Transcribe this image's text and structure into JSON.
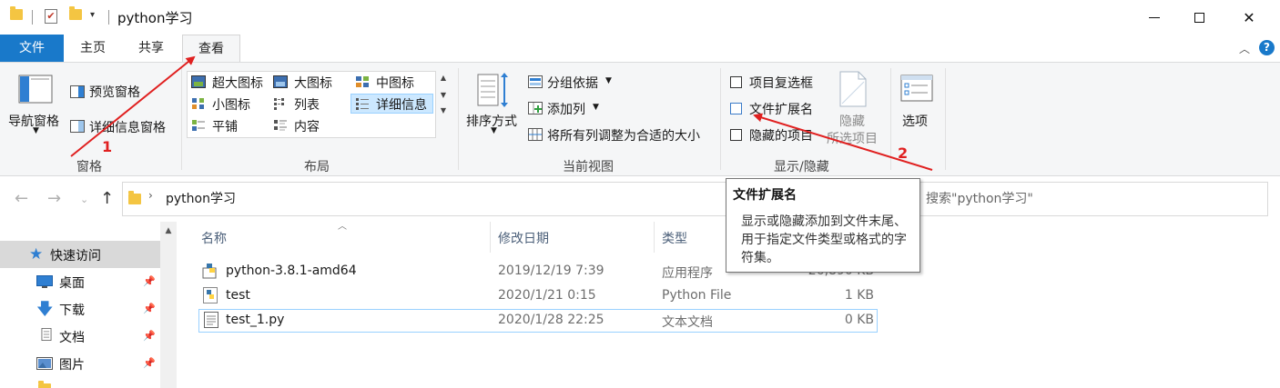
{
  "window": {
    "title": "python学习"
  },
  "ribbon_tabs": [
    "文件",
    "主页",
    "共享",
    "查看"
  ],
  "ribbon": {
    "panes": {
      "nav_pane": "导航窗格",
      "preview_pane": "预览窗格",
      "details_pane": "详细信息窗格",
      "label": "窗格"
    },
    "layout": {
      "items": [
        "超大图标",
        "大图标",
        "中图标",
        "小图标",
        "列表",
        "详细信息",
        "平铺",
        "内容"
      ],
      "selected": "详细信息",
      "label": "布局"
    },
    "current_view": {
      "sort_by": "排序方式",
      "group_by": "分组依据",
      "add_columns": "添加列",
      "size_all_columns": "将所有列调整为合适的大小",
      "label": "当前视图"
    },
    "show_hide": {
      "item_checkboxes": "项目复选框",
      "file_extensions": "文件扩展名",
      "hidden_items": "隐藏的项目",
      "hide_selected": "隐藏",
      "hide_selected_2": "所选项目",
      "label": "显示/隐藏"
    },
    "options": "选项"
  },
  "address": {
    "path": "python学习",
    "search_placeholder": "搜索\"python学习\""
  },
  "nav": {
    "items": [
      {
        "label": "快速访问",
        "icon": "star-icon"
      },
      {
        "label": "桌面",
        "icon": "desktop-icon"
      },
      {
        "label": "下载",
        "icon": "download-icon"
      },
      {
        "label": "文档",
        "icon": "document-icon"
      },
      {
        "label": "图片",
        "icon": "picture-icon"
      }
    ]
  },
  "columns": [
    "名称",
    "修改日期",
    "类型"
  ],
  "files": [
    {
      "name": "python-3.8.1-amd64",
      "date": "2019/12/19 7:39",
      "type": "应用程序",
      "size": "26,890 KB",
      "icon": "installer-icon"
    },
    {
      "name": "test",
      "date": "2020/1/21 0:15",
      "type": "Python File",
      "size": "1 KB",
      "icon": "python-file-icon"
    },
    {
      "name": "test_1.py",
      "date": "2020/1/28 22:25",
      "type": "文本文档",
      "size": "0 KB",
      "icon": "text-file-icon"
    }
  ],
  "tooltip": {
    "title": "文件扩展名",
    "body": "显示或隐藏添加到文件末尾、用于指定文件类型或格式的字符集。"
  },
  "annotations": {
    "step1": "1",
    "step2": "2",
    "color": "#e02020"
  },
  "colors": {
    "file_tab": "#1979ca",
    "selection": "#cce8ff"
  }
}
